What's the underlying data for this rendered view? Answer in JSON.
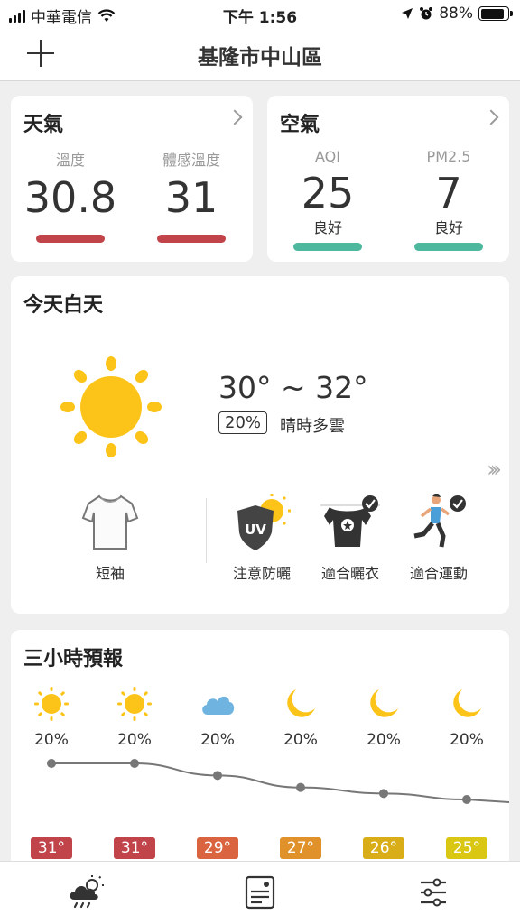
{
  "status": {
    "carrier": "中華電信",
    "time": "下午 1:56",
    "battery": "88%",
    "battery_level": 0.88
  },
  "header": {
    "title": "基隆市中山區",
    "add_icon": "plus-icon"
  },
  "weather_card": {
    "title": "天氣",
    "temp_label": "溫度",
    "temp_value": "30.8",
    "feels_label": "體感溫度",
    "feels_value": "31",
    "bar_color": "#c0444a"
  },
  "air_card": {
    "title": "空氣",
    "aqi_label": "AQI",
    "aqi_value": "25",
    "aqi_status": "良好",
    "pm_label": "PM2.5",
    "pm_value": "7",
    "pm_status": "良好",
    "bar_color": "#4db89e"
  },
  "today": {
    "title": "今天白天",
    "icon": "sun-icon",
    "temp_range": "30° ~ 32°",
    "pop": "20%",
    "condition": "晴時多雲",
    "advice": [
      {
        "icon": "tshirt-icon",
        "label": "短袖"
      },
      {
        "icon": "uv-shield-icon",
        "label": "注意防曬"
      },
      {
        "icon": "laundry-icon",
        "label": "適合曬衣"
      },
      {
        "icon": "runner-icon",
        "label": "適合運動"
      }
    ]
  },
  "forecast": {
    "title": "三小時預報",
    "items": [
      {
        "icon": "sun-icon",
        "pop": "20%",
        "temp": "31°",
        "color": "#c0444a"
      },
      {
        "icon": "sun-icon",
        "pop": "20%",
        "temp": "31°",
        "color": "#c0444a"
      },
      {
        "icon": "cloud-icon",
        "pop": "20%",
        "temp": "29°",
        "color": "#d9643f"
      },
      {
        "icon": "moon-icon",
        "pop": "20%",
        "temp": "27°",
        "color": "#e0912a"
      },
      {
        "icon": "moon-icon",
        "pop": "20%",
        "temp": "26°",
        "color": "#d9ad17"
      },
      {
        "icon": "moon-icon",
        "pop": "20%",
        "temp": "25°",
        "color": "#d9c714"
      }
    ]
  },
  "tabs": [
    {
      "icon": "weather-icon"
    },
    {
      "icon": "news-icon"
    },
    {
      "icon": "settings-sliders-icon"
    }
  ]
}
